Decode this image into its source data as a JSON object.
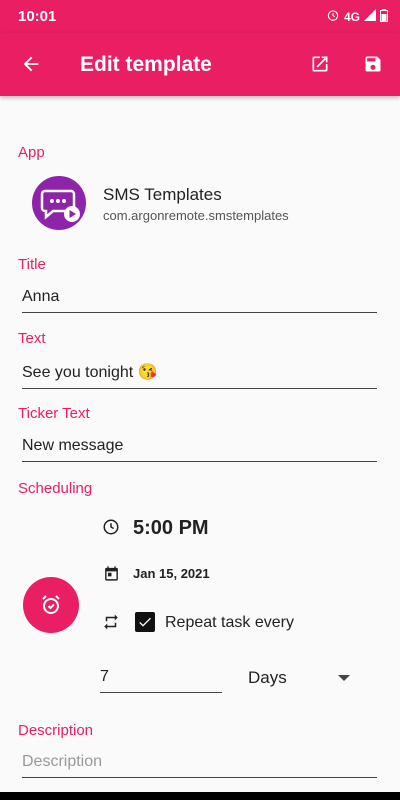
{
  "status_bar": {
    "time": "10:01",
    "network": "4G"
  },
  "app_bar": {
    "title": "Edit template"
  },
  "labels": {
    "app": "App",
    "title": "Title",
    "text": "Text",
    "ticker": "Ticker Text",
    "scheduling": "Scheduling",
    "description": "Description"
  },
  "app_info": {
    "name": "SMS Templates",
    "package": "com.argonremote.smstemplates"
  },
  "fields": {
    "title_value": "Anna",
    "text_value": "See you tonight 😘",
    "ticker_value": "New message",
    "description_placeholder": "Description"
  },
  "scheduling": {
    "time": "5:00 PM",
    "date": "Jan 15, 2021",
    "repeat_label": "Repeat task every",
    "repeat_checked": true,
    "interval_value": "7",
    "interval_unit": "Days"
  },
  "colors": {
    "accent": "#e91e63",
    "app_icon": "#8e24aa"
  }
}
